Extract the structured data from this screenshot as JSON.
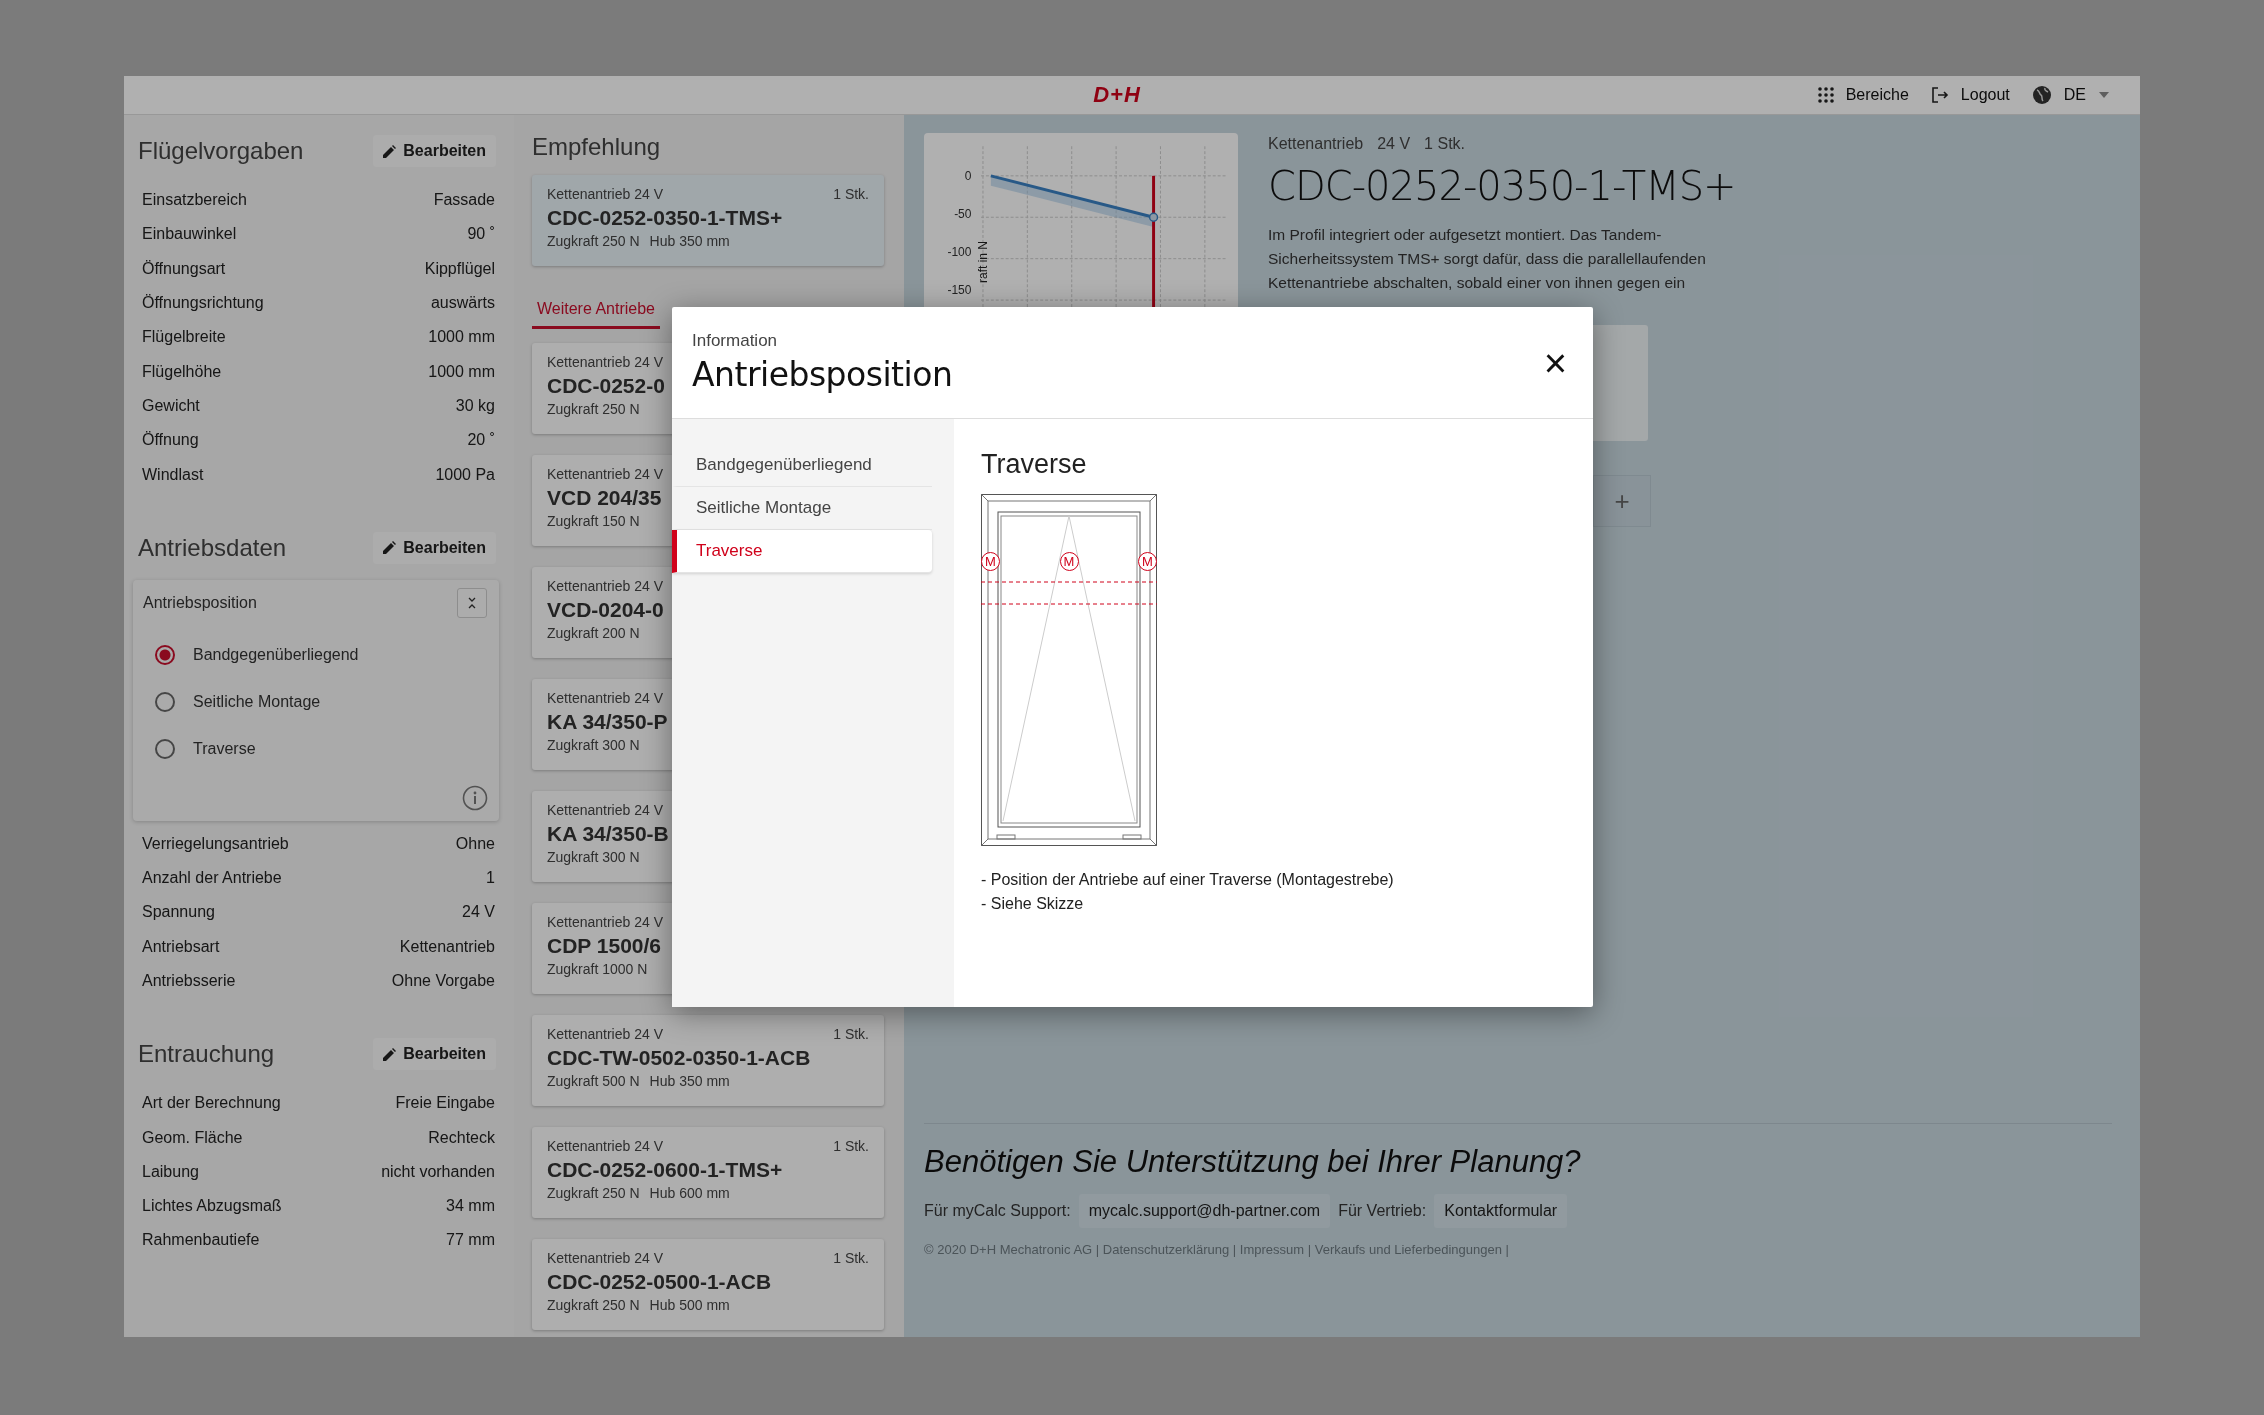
{
  "header": {
    "logo": "D+H",
    "menu": [
      {
        "label": "Bereiche"
      },
      {
        "label": "Logout"
      },
      {
        "label": "DE"
      }
    ]
  },
  "left_panel": {
    "sections": [
      {
        "title": "Flügelvorgaben",
        "edit": "Bearbeiten",
        "rows_before": [
          {
            "label": "Einsatzbereich",
            "value": "Fassade"
          },
          {
            "label": "Einbauwinkel",
            "value": "90 ˚"
          },
          {
            "label": "Öffnungsart",
            "value": "Kippflügel"
          },
          {
            "label": "Öffnungsrichtung",
            "value": "auswärts"
          },
          {
            "label": "Flügelbreite",
            "value": "1000 mm"
          },
          {
            "label": "Flügelhöhe",
            "value": "1000 mm"
          },
          {
            "label": "Gewicht",
            "value": "30 kg"
          },
          {
            "label": "Öffnung",
            "value": "20 ˚"
          },
          {
            "label": "Windlast",
            "value": "1000 Pa"
          }
        ]
      },
      {
        "title": "Antriebsdaten",
        "edit": "Bearbeiten",
        "position_card": {
          "title": "Antriebsposition",
          "options": [
            {
              "label": "Bandgegenüberliegend",
              "selected": true
            },
            {
              "label": "Seitliche Montage",
              "selected": false
            },
            {
              "label": "Traverse",
              "selected": false
            }
          ]
        },
        "rows_after": [
          {
            "label": "Verriegelungsantrieb",
            "value": "Ohne"
          },
          {
            "label": "Anzahl der Antriebe",
            "value": "1"
          },
          {
            "label": "Spannung",
            "value": "24 V"
          },
          {
            "label": "Antriebsart",
            "value": "Kettenantrieb"
          },
          {
            "label": "Antriebsserie",
            "value": "Ohne Vorgabe"
          }
        ]
      },
      {
        "title": "Entrauchung",
        "edit": "Bearbeiten",
        "rows_before": [
          {
            "label": "Art der Berechnung",
            "value": "Freie Eingabe"
          },
          {
            "label": "Geom. Fläche",
            "value": "Rechteck"
          },
          {
            "label": "Laibung",
            "value": "nicht vorhanden"
          },
          {
            "label": "Lichtes Abzugsmaß",
            "value": "34 mm"
          },
          {
            "label": "Rahmenbautiefe",
            "value": "77 mm"
          }
        ]
      }
    ]
  },
  "recommendation": {
    "title": "Empfehlung",
    "card": {
      "type": "Kettenantrieb 24 V",
      "qty": "1 Stk.",
      "name": "CDC-0252-0350-1-TMS+",
      "force": "Zugkraft 250 N",
      "stroke": "Hub 350 mm",
      "selected": true
    },
    "tabs": [
      {
        "label": "Weitere Antriebe",
        "selected": true
      }
    ],
    "cards": [
      {
        "type": "Kettenantrieb 24 V",
        "name": "CDC-0252-0",
        "force": "Zugkraft 250 N",
        "selected": false
      },
      {
        "type": "Kettenantrieb 24 V",
        "name": "VCD 204/35",
        "force": "Zugkraft 150 N",
        "selected": false
      },
      {
        "type": "Kettenantrieb 24 V",
        "name": "VCD-0204-0",
        "force": "Zugkraft 200 N",
        "selected": false
      },
      {
        "type": "Kettenantrieb 24 V",
        "name": "KA 34/350-P",
        "force": "Zugkraft 300 N",
        "selected": false
      },
      {
        "type": "Kettenantrieb 24 V",
        "name": "KA 34/350-B",
        "force": "Zugkraft 300 N",
        "selected": false
      },
      {
        "type": "Kettenantrieb 24 V",
        "name": "CDP 1500/6",
        "force": "Zugkraft 1000 N",
        "selected": false
      },
      {
        "type": "Kettenantrieb 24 V",
        "qty": "1 Stk.",
        "name": "CDC-TW-0502-0350-1-ACB",
        "force": "Zugkraft 500 N",
        "stroke": "Hub 350 mm",
        "selected": false
      },
      {
        "type": "Kettenantrieb 24 V",
        "qty": "1 Stk.",
        "name": "CDC-0252-0600-1-TMS+",
        "force": "Zugkraft 250 N",
        "stroke": "Hub 600 mm",
        "selected": false
      },
      {
        "type": "Kettenantrieb 24 V",
        "qty": "1 Stk.",
        "name": "CDC-0252-0500-1-ACB",
        "force": "Zugkraft 250 N",
        "stroke": "Hub 500 mm",
        "selected": false
      }
    ]
  },
  "detail": {
    "chart": {
      "yticks": [
        "0",
        "-50",
        "-100",
        "-150"
      ],
      "ylabel": "raft in N"
    },
    "meta": [
      "Kettenantrieb",
      "24 V",
      "1 Stk."
    ],
    "title": "CDC-0252-0350-1-TMS+",
    "description": "Im Profil integriert oder aufgesetzt montiert. Das Tandem-Sicherheitssystem TMS+ sorgt dafür, dass die parallellaufenden Kettenantriebe abschalten, sobald einer von ihnen gegen ein",
    "add_button": "+"
  },
  "footer": {
    "heading": "Benötigen Sie Unterstützung bei Ihrer Planung?",
    "support_label": "Für myCalc Support:",
    "support_email": "mycalc.support@dh-partner.com",
    "sales_label": "Für Vertrieb:",
    "sales_link": "Kontaktformular",
    "copyright": "© 2020 D+H Mechatronic AG | Datenschutzerklärung | Impressum | Verkaufs und Lieferbedingungen |"
  },
  "modal": {
    "kicker": "Information",
    "title": "Antriebsposition",
    "close": "×",
    "nav": [
      {
        "label": "Bandgegenüberliegend",
        "selected": false
      },
      {
        "label": "Seitliche Montage",
        "selected": false
      },
      {
        "label": "Traverse",
        "selected": true
      }
    ],
    "content_title": "Traverse",
    "motor_marks": [
      "M",
      "M",
      "M"
    ],
    "notes": [
      "- Position der Antriebe auf einer Traverse (Montagestrebe)",
      "- Siehe Skizze"
    ]
  }
}
